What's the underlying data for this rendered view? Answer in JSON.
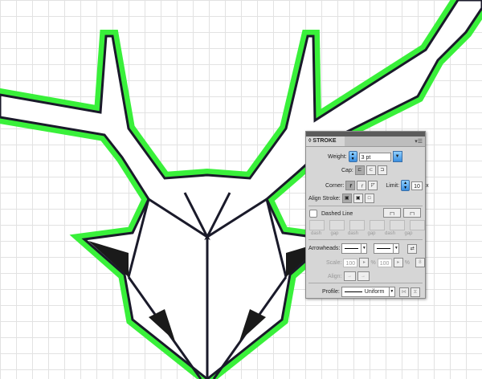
{
  "panel": {
    "title": "STROKE",
    "menu_icon": "panel-menu-icon",
    "weight_label": "Weight:",
    "weight_value": "3 pt",
    "cap_label": "Cap:",
    "corner_label": "Corner:",
    "limit_label": "Limit:",
    "limit_value": "10",
    "limit_suffix": "x",
    "align_label": "Align Stroke:",
    "dashed_label": "Dashed Line",
    "dash_fields": [
      "dash",
      "gap",
      "dash",
      "gap",
      "dash",
      "gap"
    ],
    "arrowheads_label": "Arrowheads:",
    "scale_label": "Scale:",
    "scale_start": "100",
    "scale_end": "100",
    "percent": "%",
    "align_arrow_label": "Align:",
    "profile_label": "Profile:",
    "profile_value": "Uniform"
  },
  "colors": {
    "glow": "#39f03a",
    "stroke": "#1a1a2a",
    "accent": "#3a8fe0"
  }
}
